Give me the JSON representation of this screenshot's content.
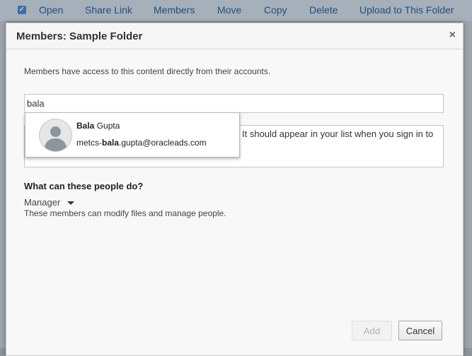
{
  "toolbar": {
    "items": [
      "Open",
      "Share Link",
      "Members",
      "Move",
      "Copy",
      "Delete",
      "Upload to This Folder"
    ],
    "checkbox": "check-icon"
  },
  "dialog": {
    "title": "Members: Sample Folder",
    "close_icon": "×",
    "description": "Members have access to this content directly from their accounts.",
    "search_value": "bala",
    "message_text": "It should appear in your list when you sign in to",
    "suggestion": {
      "name_match": "Bala",
      "name_rest": " Gupta",
      "email_prefix": "metcs-",
      "email_match": "bala",
      "email_rest": ".gupta@oracleads.com",
      "avatar": "user-avatar-icon"
    },
    "permissions_title": "What can these people do?",
    "role_value": "Manager",
    "role_description": "These members can modify files and manage people.",
    "add_label": "Add",
    "cancel_label": "Cancel"
  },
  "colors": {
    "accent_link": "#1f4f7f",
    "toolbar_bg": "#a6b0ba",
    "dialog_bg": "#f8f8f8"
  }
}
